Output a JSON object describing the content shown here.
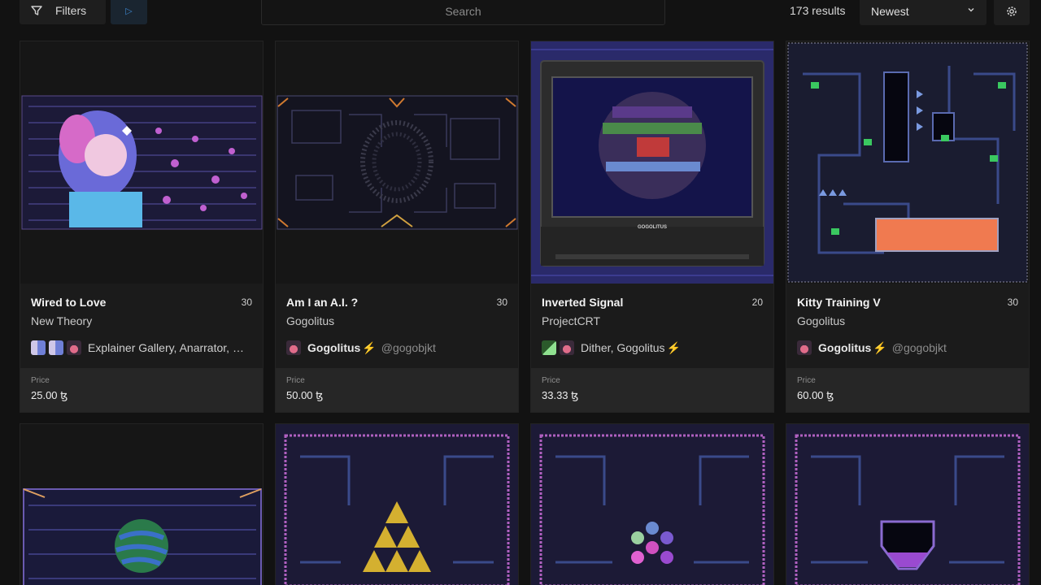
{
  "toolbar": {
    "filters_label": "Filters",
    "search_placeholder": "Search",
    "results_count": "173 results",
    "sort_selected": "Newest"
  },
  "cards": [
    {
      "title": "Wired to Love",
      "editions": "30",
      "subtitle": "New Theory",
      "creators": "Explainer Gallery, Anarrator, Gogo...",
      "price_label": "Price",
      "price": "25.00 ꜩ"
    },
    {
      "title": "Am I an A.I. ?",
      "editions": "30",
      "subtitle": "Gogolitus",
      "creator_name": "Gogolitus",
      "creator_handle": "@gogobjkt",
      "price_label": "Price",
      "price": "50.00 ꜩ"
    },
    {
      "title": "Inverted Signal",
      "editions": "20",
      "subtitle": "ProjectCRT",
      "creators": "Dither, Gogolitus",
      "price_label": "Price",
      "price": "33.33 ꜩ",
      "tv_brand": "GOGOLITUS"
    },
    {
      "title": "Kitty Training V",
      "editions": "30",
      "subtitle": "Gogolitus",
      "creator_name": "Gogolitus",
      "creator_handle": "@gogobjkt",
      "price_label": "Price",
      "price": "60.00 ꜩ"
    }
  ],
  "colors": {
    "background": "#121212",
    "card": "#1b1b1b",
    "price_box": "#262626",
    "accent_blue": "#3b82c8",
    "bolt": "#f5b50a"
  }
}
